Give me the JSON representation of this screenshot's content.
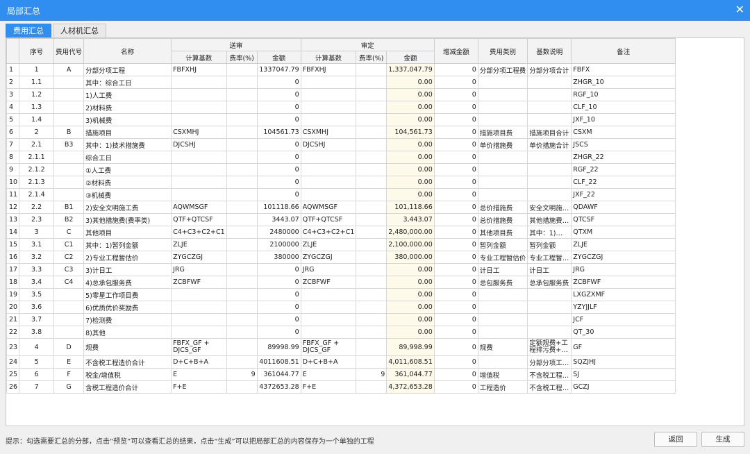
{
  "window": {
    "title": "局部汇总",
    "close_glyph": "✕"
  },
  "tabs": [
    {
      "label": "费用汇总",
      "active": true
    },
    {
      "label": "人材机汇总",
      "active": false
    }
  ],
  "table": {
    "headers": {
      "seq": "序号",
      "code": "费用代号",
      "name": "名称",
      "sent_group": "送审",
      "approved_group": "审定",
      "calc_base": "计算基数",
      "rate": "费率(%)",
      "amount": "金额",
      "diff": "增减金额",
      "category": "费用类别",
      "base_desc": "基数说明",
      "remark": "备注"
    },
    "rows": [
      [
        "1",
        "1",
        "A",
        "分部分项工程",
        "FBFXHJ",
        "",
        "1337047.79",
        "FBFXHJ",
        "",
        "1,337,047.79",
        "0",
        "分部分项工程费",
        "分部分项合计",
        "FBFX"
      ],
      [
        "2",
        "1.1",
        "",
        "其中：综合工日",
        "",
        "",
        "0",
        "",
        "",
        "0.00",
        "0",
        "",
        "",
        "ZHGR_10"
      ],
      [
        "3",
        "1.2",
        "",
        "1)人工费",
        "",
        "",
        "0",
        "",
        "",
        "0.00",
        "0",
        "",
        "",
        "RGF_10"
      ],
      [
        "4",
        "1.3",
        "",
        "2)材料费",
        "",
        "",
        "0",
        "",
        "",
        "0.00",
        "0",
        "",
        "",
        "CLF_10"
      ],
      [
        "5",
        "1.4",
        "",
        "3)机械费",
        "",
        "",
        "0",
        "",
        "",
        "0.00",
        "0",
        "",
        "",
        "JXF_10"
      ],
      [
        "6",
        "2",
        "B",
        "措施项目",
        "CSXMHJ",
        "",
        "104561.73",
        "CSXMHJ",
        "",
        "104,561.73",
        "0",
        "措施项目费",
        "措施项目合计",
        "CSXM"
      ],
      [
        "7",
        "2.1",
        "B3",
        "其中：1)技术措施费",
        "DJCSHJ",
        "",
        "0",
        "DJCSHJ",
        "",
        "0.00",
        "0",
        "单价措施费",
        "单价措施合计",
        "JSCS"
      ],
      [
        "8",
        "2.1.1",
        "",
        "综合工日",
        "",
        "",
        "0",
        "",
        "",
        "0.00",
        "0",
        "",
        "",
        "ZHGR_22"
      ],
      [
        "9",
        "2.1.2",
        "",
        "①人工费",
        "",
        "",
        "0",
        "",
        "",
        "0.00",
        "0",
        "",
        "",
        "RGF_22"
      ],
      [
        "10",
        "2.1.3",
        "",
        "②材料费",
        "",
        "",
        "0",
        "",
        "",
        "0.00",
        "0",
        "",
        "",
        "CLF_22"
      ],
      [
        "11",
        "2.1.4",
        "",
        "③机械费",
        "",
        "",
        "0",
        "",
        "",
        "0.00",
        "0",
        "",
        "",
        "JXF_22"
      ],
      [
        "12",
        "2.2",
        "B1",
        "2)安全文明施工费",
        "AQWMSGF",
        "",
        "101118.66",
        "AQWMSGF",
        "",
        "101,118.66",
        "0",
        "总价措施费",
        "安全文明施…",
        "QDAWF"
      ],
      [
        "13",
        "2.3",
        "B2",
        "3)其他措施费(费率类)",
        "QTF+QTCSF",
        "",
        "3443.07",
        "QTF+QTCSF",
        "",
        "3,443.07",
        "0",
        "总价措施费",
        "其他措施费…",
        "QTCSF"
      ],
      [
        "14",
        "3",
        "C",
        "其他项目",
        "C4+C3+C2+C1",
        "",
        "2480000",
        "C4+C3+C2+C1",
        "",
        "2,480,000.00",
        "0",
        "其他项目费",
        "其中：1)…",
        "QTXM"
      ],
      [
        "15",
        "3.1",
        "C1",
        "其中：1)暂列金额",
        "ZLJE",
        "",
        "2100000",
        "ZLJE",
        "",
        "2,100,000.00",
        "0",
        "暂列金额",
        "暂列金额",
        "ZLJE"
      ],
      [
        "16",
        "3.2",
        "C2",
        "2)专业工程暂估价",
        "ZYGCZGJ",
        "",
        "380000",
        "ZYGCZGJ",
        "",
        "380,000.00",
        "0",
        "专业工程暂估价",
        "专业工程暂…",
        "ZYGCZGJ"
      ],
      [
        "17",
        "3.3",
        "C3",
        "3)计日工",
        "JRG",
        "",
        "0",
        "JRG",
        "",
        "0.00",
        "0",
        "计日工",
        "计日工",
        "JRG"
      ],
      [
        "18",
        "3.4",
        "C4",
        "4)总承包服务费",
        "ZCBFWF",
        "",
        "0",
        "ZCBFWF",
        "",
        "0.00",
        "0",
        "总包服务费",
        "总承包服务费",
        "ZCBFWF"
      ],
      [
        "19",
        "3.5",
        "",
        "5)零星工作项目费",
        "",
        "",
        "0",
        "",
        "",
        "0.00",
        "0",
        "",
        "",
        "LXGZXMF"
      ],
      [
        "20",
        "3.6",
        "",
        "6)优质优价奖励费",
        "",
        "",
        "0",
        "",
        "",
        "0.00",
        "0",
        "",
        "",
        "YZYJJLF"
      ],
      [
        "21",
        "3.7",
        "",
        "7)检测费",
        "",
        "",
        "0",
        "",
        "",
        "0.00",
        "0",
        "",
        "",
        "JCF"
      ],
      [
        "22",
        "3.8",
        "",
        "8)其他",
        "",
        "",
        "0",
        "",
        "",
        "0.00",
        "0",
        "",
        "",
        "QT_30"
      ],
      [
        "23",
        "4",
        "D",
        "规费",
        "FBFX_GF + DJCS_GF",
        "",
        "89998.99",
        "FBFX_GF + DJCS_GF",
        "",
        "89,998.99",
        "0",
        "规费",
        "定额规费+工程排污费+…",
        "GF"
      ],
      [
        "24",
        "5",
        "E",
        "不含税工程造价合计",
        "D+C+B+A",
        "",
        "4011608.51",
        "D+C+B+A",
        "",
        "4,011,608.51",
        "0",
        "",
        "分部分项工…",
        "SQZJHJ"
      ],
      [
        "25",
        "6",
        "F",
        "税金/增值税",
        "E",
        "9",
        "361044.77",
        "E",
        "9",
        "361,044.77",
        "0",
        "增值税",
        "不含税工程…",
        "SJ"
      ],
      [
        "26",
        "7",
        "G",
        "含税工程造价合计",
        "F+E",
        "",
        "4372653.28",
        "F+E",
        "",
        "4,372,653.28",
        "0",
        "工程造价",
        "不含税工程…",
        "GCZJ"
      ]
    ]
  },
  "footer": {
    "tip": "提示：勾选需要汇总的分部，点击“预览”可以查看汇总的结果，点击“生成”可以把局部汇总的内容保存为一个单独的工程",
    "return_label": "返回",
    "generate_label": "生成"
  }
}
